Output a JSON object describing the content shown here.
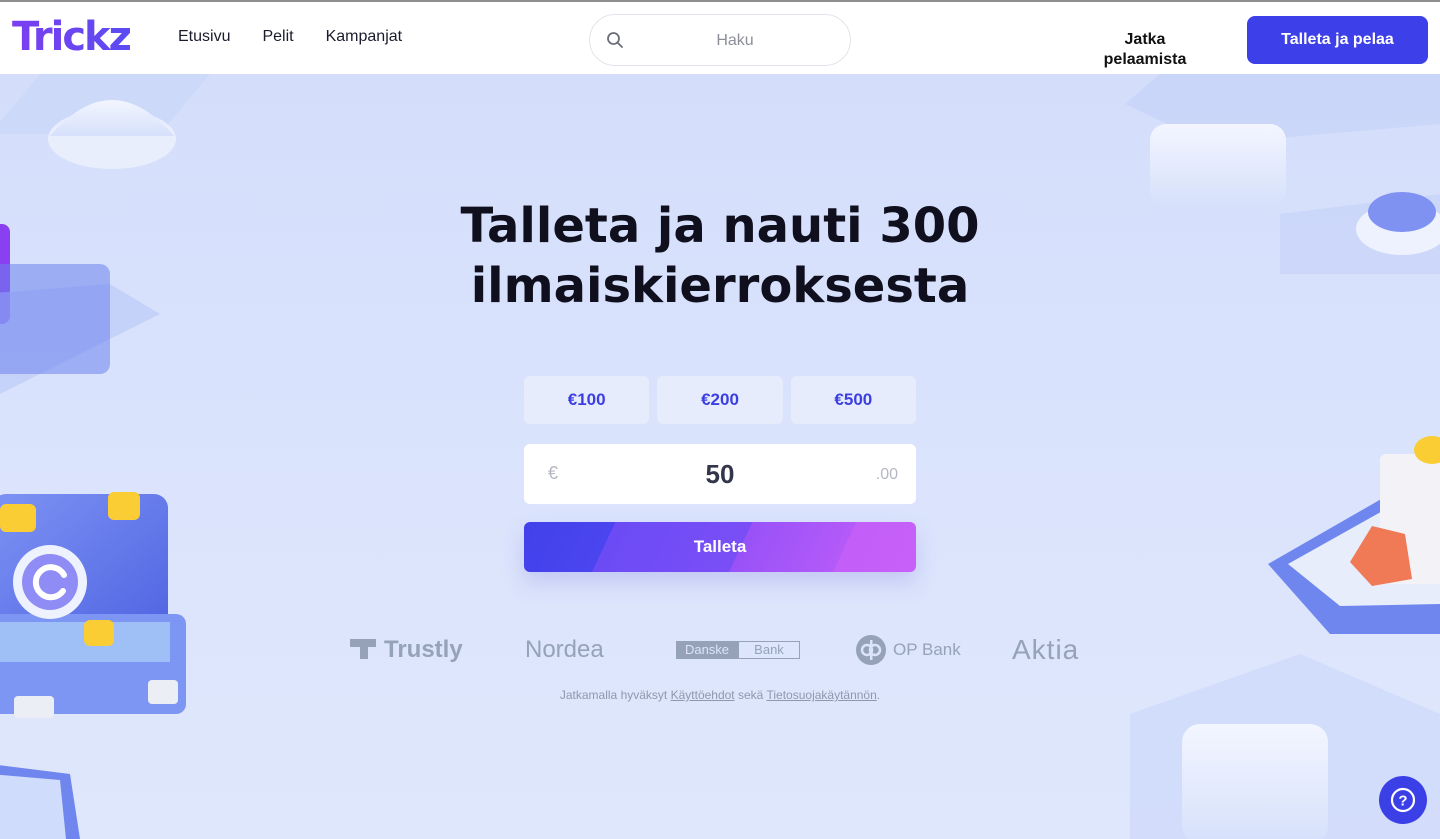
{
  "header": {
    "logo": "Trickz",
    "nav": [
      "Etusivu",
      "Pelit",
      "Kampanjat"
    ],
    "search_placeholder": "Haku",
    "continue_label": "Jatka pelaamista",
    "cta_label": "Talleta ja pelaa"
  },
  "hero": {
    "title": "Talleta ja nauti 300 ilmaiskierroksesta",
    "amount_options": [
      "€100",
      "€200",
      "€500"
    ],
    "currency_symbol": "€",
    "amount_value": "50",
    "cents": ".00",
    "submit_label": "Talleta",
    "banks": [
      "Trustly",
      "Nordea",
      "Danske",
      "Bank",
      "OP Bank",
      "Aktia"
    ],
    "terms": {
      "prefix": "Jatkamalla hyväksyt",
      "terms_link": "Käyttöehdot",
      "middle": "sekä",
      "privacy_link": "Tietosuojakäytännön",
      "suffix": "."
    }
  },
  "help_label": "?",
  "colors": {
    "accent": "#3d40e8",
    "background": "#d9e3fb",
    "amount_text": "#3b3ee0",
    "bank_logo": "#95a2b7"
  }
}
